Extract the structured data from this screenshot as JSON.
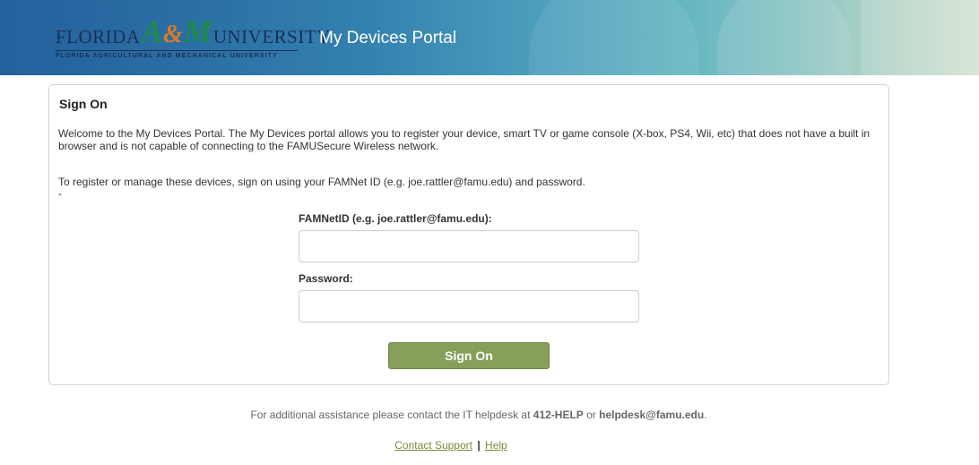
{
  "header": {
    "logo": {
      "word_left": "FLORIDA",
      "word_a": "A",
      "word_amp": "&",
      "word_m": "M",
      "word_right": "UNIVERSITY",
      "subtitle": "FLORIDA AGRICULTURAL AND MECHANICAL UNIVERSITY"
    },
    "portal_title": "My Devices Portal",
    "colors": {
      "primary_blue": "#24609d",
      "teal": "#66b6c2"
    }
  },
  "panel": {
    "title": "Sign On",
    "intro": "Welcome to the My Devices Portal. The My Devices portal allows you to register your device, smart TV or game console (X-box, PS4, Wii, etc) that does not have a built in browser and is not capable of connecting to the FAMUSecure Wireless network.",
    "instructions": "To register or manage these devices, sign on using your FAMNet ID (e.g. joe.rattler@famu.edu) and password.",
    "dash": "-",
    "username_label": "FAMNetID (e.g. joe.rattler@famu.edu):",
    "username_value": "",
    "password_label": "Password:",
    "password_value": "",
    "signon_button": "Sign On",
    "button_color": "#86a05a"
  },
  "footer": {
    "assist_prefix": "For additional assistance please contact the IT helpdesk at ",
    "phone": "412-HELP",
    "assist_or": " or ",
    "email": "helpdesk@famu.edu",
    "assist_suffix": ".",
    "contact_link": "Contact Support",
    "separator": "|",
    "help_link": "Help"
  }
}
